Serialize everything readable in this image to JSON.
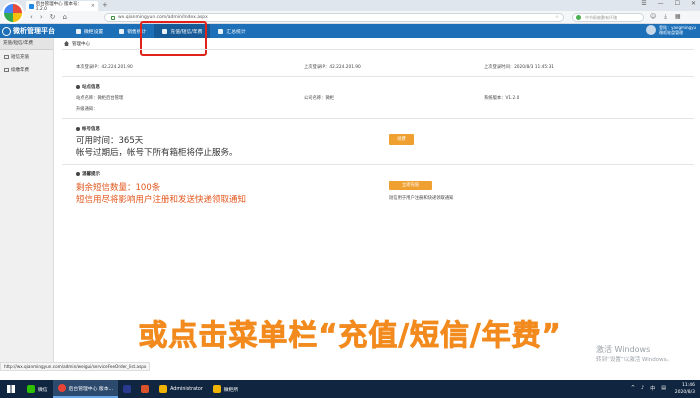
{
  "browser": {
    "tab_title": "后台管理中心 版本号：1.2.0",
    "tab_close": "×",
    "tab_add": "+",
    "url": "wx.qianmingyun.com/admin/Index.aspx",
    "search_placeholder": "中节职被敷有坏瑰",
    "nav": [
      "‹",
      "›",
      "↻",
      "⌂"
    ],
    "window_controls": [
      "☰",
      "—",
      "☐",
      "✕"
    ],
    "star": "☆"
  },
  "app": {
    "brand": "微析管理平台",
    "menu": [
      {
        "label": "微柜设置"
      },
      {
        "label": "销售统计"
      },
      {
        "label": "充值/短信/年费"
      },
      {
        "label": "汇总统计"
      }
    ],
    "user_line1": "登陆：yangmingyu",
    "user_line2": "微柜轮盘管理"
  },
  "sidebar": {
    "title": "充值/短信/年费",
    "items": [
      {
        "label": "短信充值"
      },
      {
        "label": "续缴年费"
      }
    ]
  },
  "main": {
    "breadcrumb": "管理中心",
    "login_this": "本次登录IP：42.224.201.90",
    "login_last": "上次登录IP：42.224.201.90",
    "login_time": "上次登录时间：2020/8/3 11:45:31",
    "site_section": "站点信息",
    "site_name": "站点名称：微柜后台管理",
    "company": "公司名称：微柜",
    "version": "系统版本：V1.2.0",
    "upgrade": "升级通知：",
    "account_section": "帐号信息",
    "available": "可用时间：365天",
    "expire_note": "帐号过期后，帐号下所有箱柜将停止服务。",
    "renew_btn": "续费",
    "reminder_section": "温馨提示",
    "sms_left": "剩余短信数量：100条",
    "sms_note": "短信用尽将影响用户注册和发送快递领取通知",
    "recharge_btn": "立即充值",
    "recharge_note": "短信用于用户注册和快递领取通知"
  },
  "caption": "或点击菜单栏“充值/短信/年费”",
  "watermark": {
    "line1": "激活 Windows",
    "line2": "转到“设置”以激活 Windows。"
  },
  "status_url": "http://wx.qianmingyun.com/admin/weigui/serviceFeeOrder_list.aspx",
  "taskbar": {
    "items": [
      {
        "label": "微信",
        "color": "#2dc100"
      },
      {
        "label": "后台管理中心 版本...",
        "color": "#e94335"
      },
      {
        "label": "",
        "color": "#2a3b8f"
      },
      {
        "label": "",
        "color": "#d9532c"
      },
      {
        "label": "Administrator",
        "color": "#f0b400"
      },
      {
        "label": "微柜所",
        "color": "#f0b400"
      }
    ],
    "time": "11:46",
    "date": "2020/8/3",
    "tray": [
      "^",
      "♪",
      "中",
      "▤"
    ]
  }
}
